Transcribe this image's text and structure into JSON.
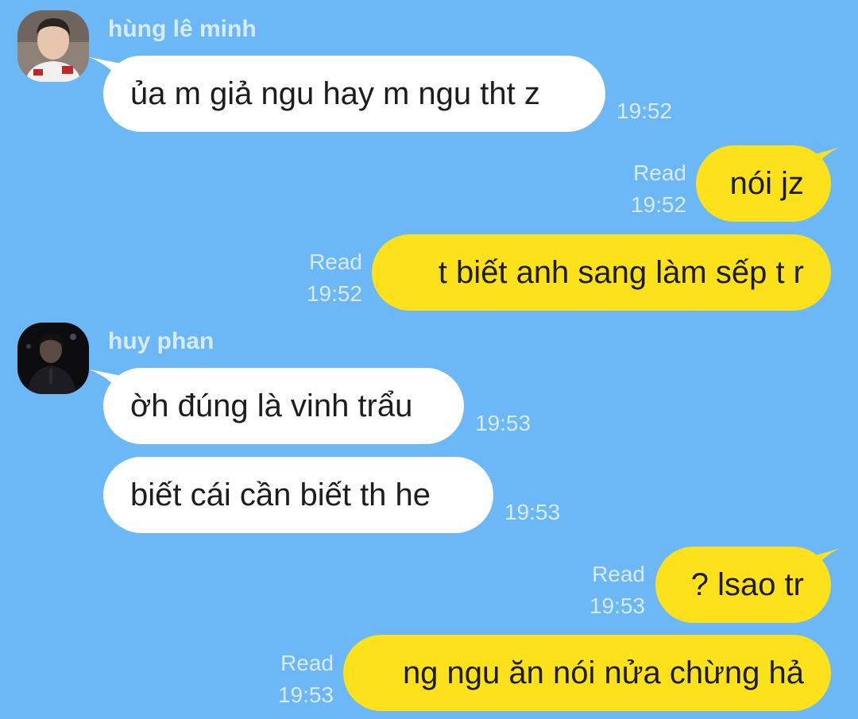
{
  "colors": {
    "background": "#6cb7f5",
    "incoming_bubble": "#ffffff",
    "outgoing_bubble": "#fde11b",
    "meta_text": "#d7ebfb"
  },
  "senders": [
    {
      "name": "hùng lê minh",
      "avatar": "avatar-photo"
    },
    {
      "name": "huy phan",
      "avatar": "avatar-photo-dark"
    }
  ],
  "messages": [
    {
      "direction": "incoming",
      "sender": "hùng lê minh",
      "text": "ủa m giả ngu hay m ngu tht z",
      "time": "19:52"
    },
    {
      "direction": "outgoing",
      "text": "nói jz",
      "status": "Read",
      "time": "19:52"
    },
    {
      "direction": "outgoing",
      "text": "t biết anh sang làm sếp t r",
      "status": "Read",
      "time": "19:52"
    },
    {
      "direction": "incoming",
      "sender": "huy phan",
      "text": "ờh đúng là vinh trẩu",
      "time": "19:53"
    },
    {
      "direction": "incoming",
      "sender": "huy phan",
      "text": "biết cái cần biết th he",
      "time": "19:53"
    },
    {
      "direction": "outgoing",
      "text": "? lsao tr",
      "status": "Read",
      "time": "19:53"
    },
    {
      "direction": "outgoing",
      "text": "ng ngu ăn nói nửa chừng hả",
      "status": "Read",
      "time": "19:53"
    }
  ]
}
